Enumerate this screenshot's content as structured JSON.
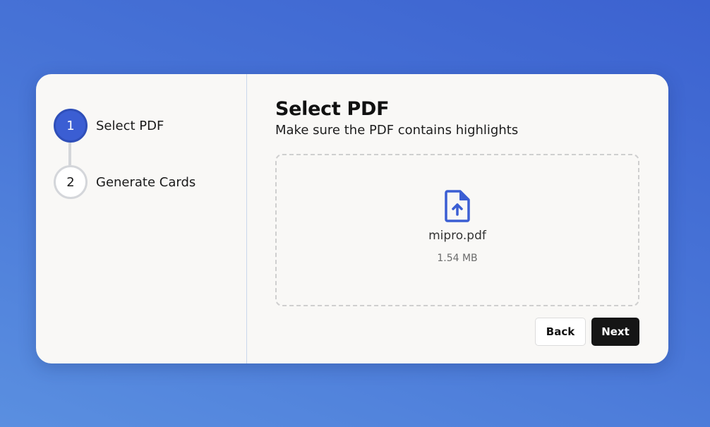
{
  "steps": [
    {
      "number": "1",
      "label": "Select PDF",
      "state": "active"
    },
    {
      "number": "2",
      "label": "Generate Cards",
      "state": "inactive"
    }
  ],
  "main": {
    "title": "Select PDF",
    "subtitle": "Make sure the PDF contains highlights"
  },
  "file": {
    "icon": "file-upload-icon",
    "name": "mipro.pdf",
    "size": "1.54 MB"
  },
  "actions": {
    "back_label": "Back",
    "next_label": "Next"
  },
  "colors": {
    "accent": "#3b5ed3",
    "background_gradient": [
      "#5a8fe0",
      "#3c62d0"
    ],
    "card": "#f9f8f6",
    "primary_button": "#151515"
  }
}
